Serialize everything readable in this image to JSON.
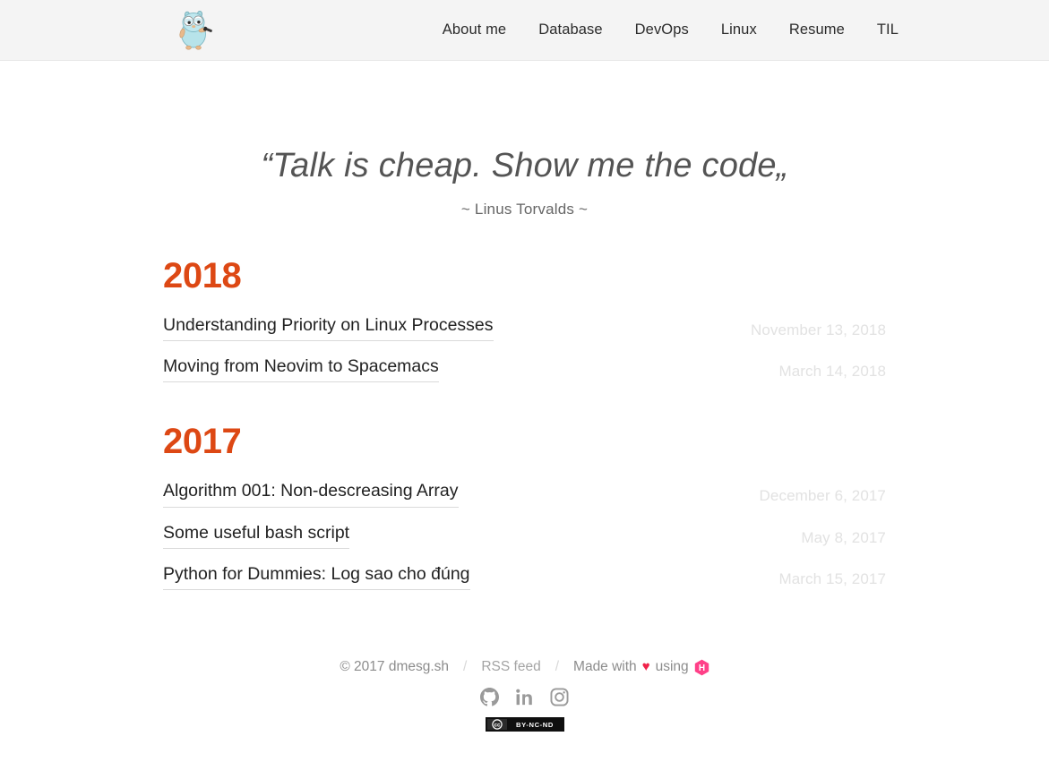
{
  "header": {
    "brand": {
      "icon": "go-gopher-logo",
      "alt": "dmesg.sh gopher logo"
    },
    "nav": [
      {
        "label": "About me",
        "name": "nav-about-me"
      },
      {
        "label": "Database",
        "name": "nav-database"
      },
      {
        "label": "DevOps",
        "name": "nav-devops"
      },
      {
        "label": "Linux",
        "name": "nav-linux"
      },
      {
        "label": "Resume",
        "name": "nav-resume"
      },
      {
        "label": "TIL",
        "name": "nav-til"
      }
    ]
  },
  "hero": {
    "quote": "“Talk is cheap. Show me the code„",
    "author": "~ Linus Torvalds ~"
  },
  "archive": {
    "groups": [
      {
        "year": "2018",
        "posts": [
          {
            "title": "Understanding Priority on Linux Processes",
            "date": "November 13, 2018"
          },
          {
            "title": "Moving from Neovim to Spacemacs",
            "date": "March 14, 2018"
          }
        ]
      },
      {
        "year": "2017",
        "posts": [
          {
            "title": "Algorithm 001: Non-descreasing Array",
            "date": "December 6, 2017"
          },
          {
            "title": "Some useful bash script",
            "date": "May 8, 2017"
          },
          {
            "title": "Python for Dummies: Log sao cho đúng",
            "date": "March 15, 2017"
          }
        ]
      }
    ]
  },
  "footer": {
    "copyright": "© 2017 dmesg.sh",
    "separator": "/",
    "rss_label": "RSS feed",
    "made_with_prefix": "Made with",
    "heart": "♥",
    "made_with_suffix": "using",
    "hugo_letter": "H",
    "social": [
      {
        "label": "GitHub",
        "name": "github-icon"
      },
      {
        "label": "LinkedIn",
        "name": "linkedin-icon"
      },
      {
        "label": "Instagram",
        "name": "instagram-icon"
      }
    ],
    "license": {
      "cc_mark": "cc",
      "terms": "BY-NC-ND"
    }
  },
  "colors": {
    "accent": "#dd4814",
    "header_bg": "#f4f4f4",
    "heart": "#f0224a",
    "hugo": "#ff4088",
    "date": "#e2e2e2"
  }
}
